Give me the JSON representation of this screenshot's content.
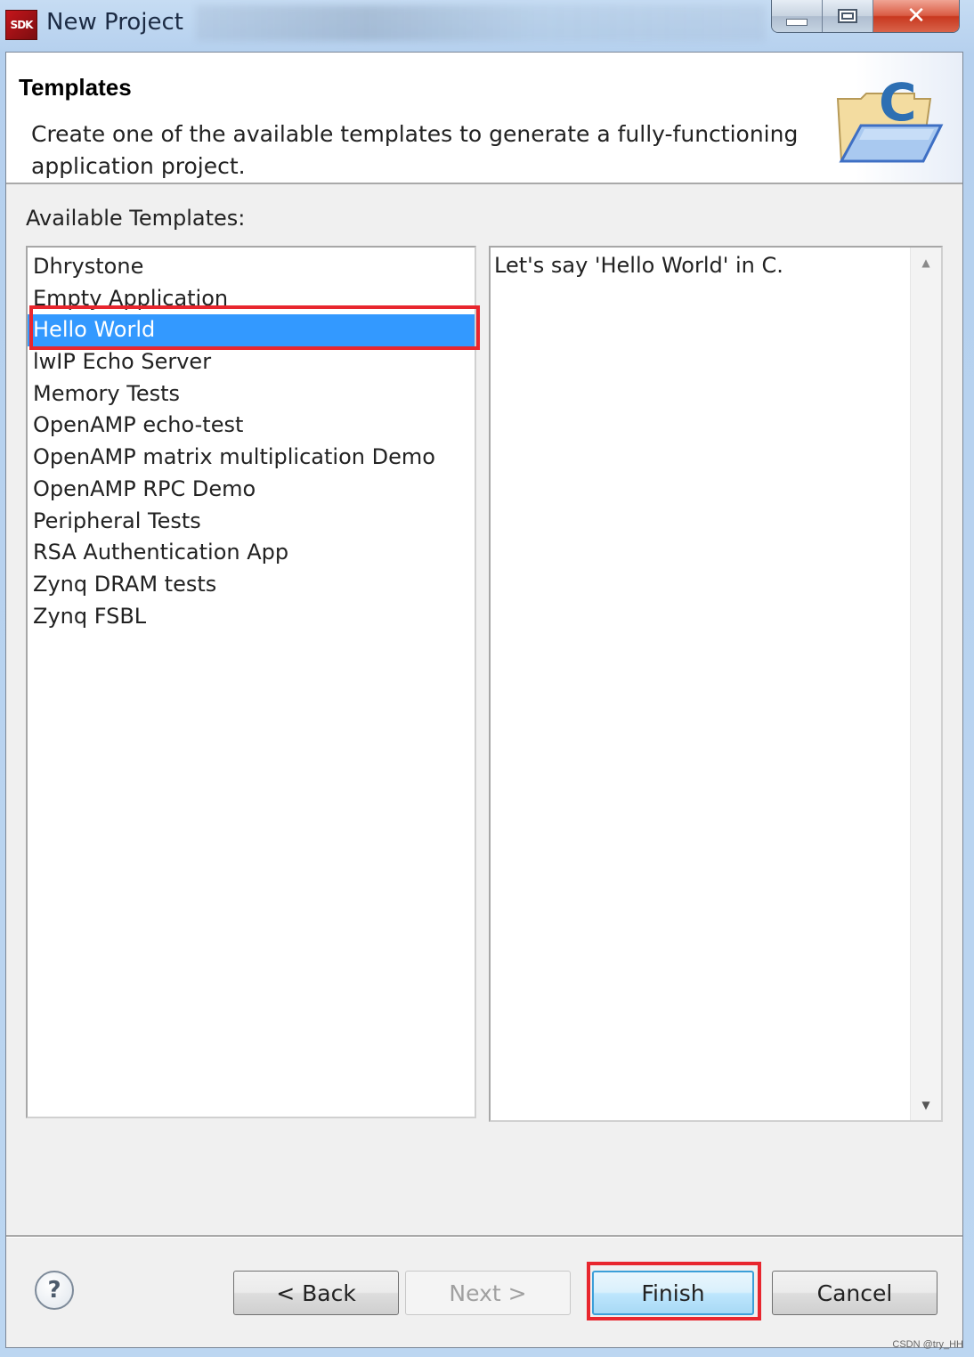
{
  "window": {
    "app_icon_label": "SDK",
    "title": "New Project",
    "close_glyph": "✕"
  },
  "header": {
    "title": "Templates",
    "description": "Create one of the available templates to generate a fully-functioning application project.",
    "image_letter": "C"
  },
  "templates": {
    "label": "Available Templates:",
    "items": [
      {
        "label": "Dhrystone"
      },
      {
        "label": "Empty Application"
      },
      {
        "label": "Hello World",
        "selected": true
      },
      {
        "label": "lwIP Echo Server"
      },
      {
        "label": "Memory Tests"
      },
      {
        "label": "OpenAMP echo-test"
      },
      {
        "label": "OpenAMP matrix multiplication Demo"
      },
      {
        "label": "OpenAMP RPC Demo"
      },
      {
        "label": "Peripheral Tests"
      },
      {
        "label": "RSA Authentication App"
      },
      {
        "label": "Zynq DRAM tests"
      },
      {
        "label": "Zynq FSBL"
      }
    ],
    "selected_description": "Let's say 'Hello World' in C."
  },
  "scrollbar": {
    "up_glyph": "▲",
    "down_glyph": "▼"
  },
  "footer": {
    "help_glyph": "?",
    "back_label": "< Back",
    "next_label": "Next >",
    "finish_label": "Finish",
    "cancel_label": "Cancel"
  },
  "colors": {
    "selection": "#3399ff",
    "annotation_red": "#e8262e",
    "default_button_border": "#3c9fd9"
  },
  "watermark": "CSDN @try_HH"
}
